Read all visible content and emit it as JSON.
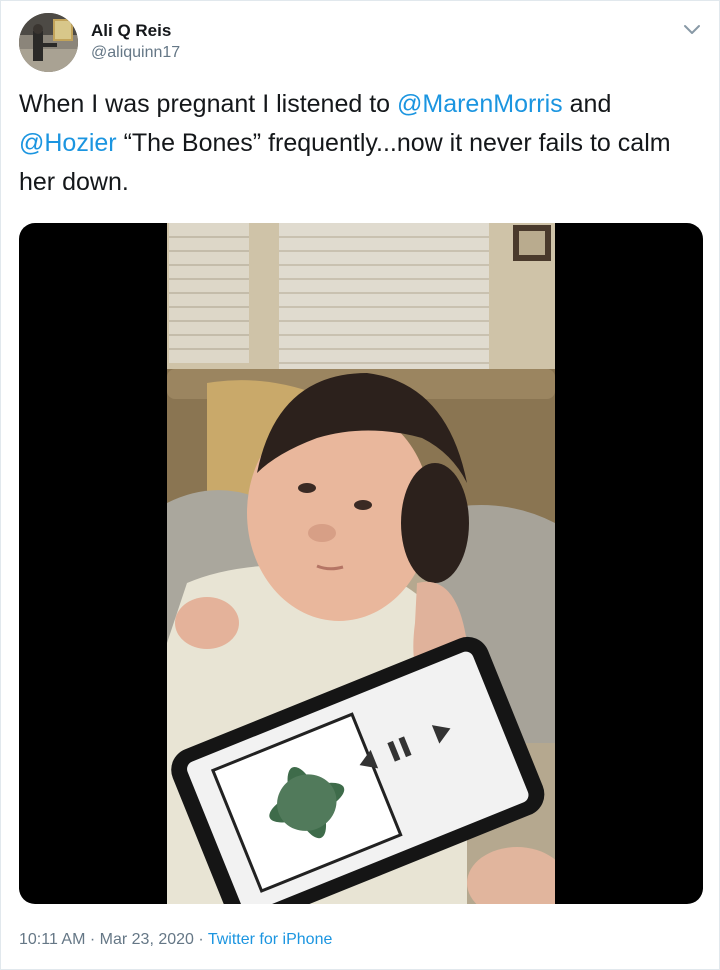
{
  "author": {
    "name": "Ali Q Reis",
    "handle": "@aliquinn17"
  },
  "tweet": {
    "text_1": "When I was pregnant I listened to ",
    "mention_1": "@MarenMorris",
    "text_2": " and ",
    "mention_2": "@Hozier",
    "text_3": " “The Bones” frequently...now it never fails to calm her down."
  },
  "media": {
    "type": "video"
  },
  "footer": {
    "time": "10:11 AM",
    "separator_1": " · ",
    "date": "Mar 23, 2020",
    "separator_2": " · ",
    "source": "Twitter for iPhone"
  },
  "colors": {
    "link": "#1b95e0",
    "secondary_text": "#657786",
    "primary_text": "#14171a",
    "border": "#e1e8ed"
  },
  "icons": {
    "menu": "chevron-down-icon"
  }
}
